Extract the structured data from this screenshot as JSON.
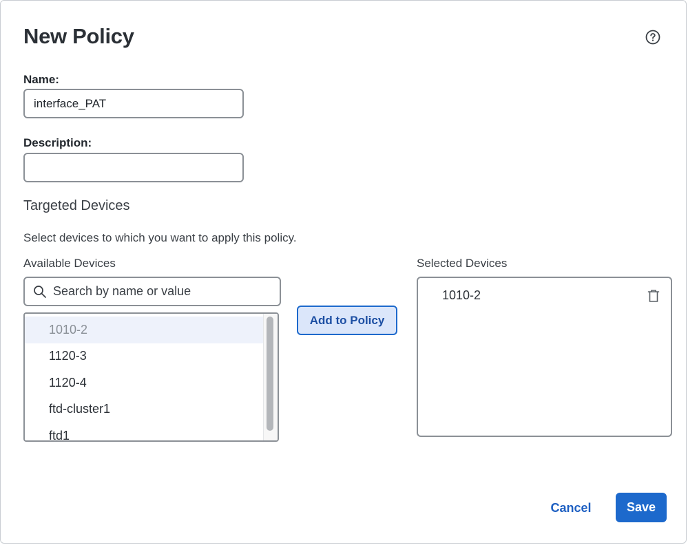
{
  "dialog": {
    "title": "New Policy",
    "help_icon": "help-circle-icon"
  },
  "form": {
    "name_label": "Name:",
    "name_value": "interface_PAT",
    "description_label": "Description:",
    "description_value": ""
  },
  "targeted_devices": {
    "section_title": "Targeted Devices",
    "instruction": "Select devices to which you want to apply this policy.",
    "available_label": "Available Devices",
    "selected_label": "Selected Devices",
    "search_placeholder": "Search by name or value",
    "search_icon": "search-icon",
    "available_devices": [
      {
        "label": "1010-2",
        "disabled": true
      },
      {
        "label": "1120-3",
        "disabled": false
      },
      {
        "label": "1120-4",
        "disabled": false
      },
      {
        "label": "ftd-cluster1",
        "disabled": false
      },
      {
        "label": "ftd1",
        "disabled": false
      }
    ],
    "add_button_label": "Add to Policy",
    "selected_devices": [
      {
        "label": "1010-2",
        "remove_icon": "trash-icon"
      }
    ]
  },
  "footer": {
    "cancel_label": "Cancel",
    "save_label": "Save"
  },
  "colors": {
    "primary": "#1d69cc",
    "add_button_bg": "#dbe6fa",
    "disabled_row_bg": "#eef2fb"
  }
}
